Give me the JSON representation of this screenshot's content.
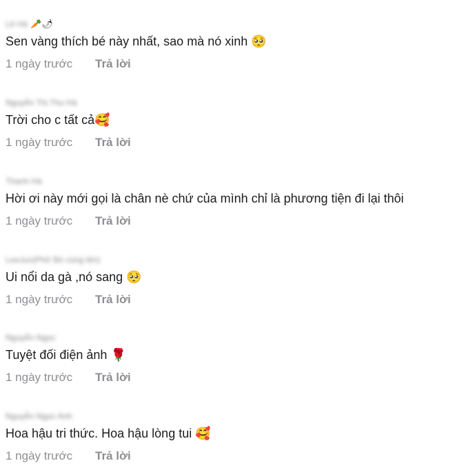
{
  "comments": [
    {
      "author": "Lê Hà",
      "author_emoji": "🥕🌶",
      "text": "Sen vàng thích bé này nhất, sao mà nó xinh 🥺",
      "time": "1 ngày trước",
      "reply": "Trả lời"
    },
    {
      "author": "Nguyễn Thị Thu Hà",
      "author_emoji": "",
      "text": "Trời cho c tất cả🥰",
      "time": "1 ngày trước",
      "reply": "Trả lời"
    },
    {
      "author": "Thanh Hà",
      "author_emoji": "",
      "text": "Hời ơi này mới gọi là chân nè chứ của mình chỉ là phương tiện đi lại thôi",
      "time": "1 ngày trước",
      "reply": "Trả lời"
    },
    {
      "author": "LeeJun(Phở Bò cùng tên)",
      "author_emoji": "",
      "text": "Ui nổi da gà ,nó sang 🥺",
      "time": "1 ngày trước",
      "reply": "Trả lời"
    },
    {
      "author": "Nguyễn Ngọc",
      "author_emoji": "",
      "text": "Tuyệt đối điện ảnh 🌹",
      "time": "1 ngày trước",
      "reply": "Trả lời"
    },
    {
      "author": "Nguyễn Ngọc Anh",
      "author_emoji": "",
      "text": "Hoa hậu tri thức. Hoa hậu lòng tui 🥰",
      "time": "1 ngày trước",
      "reply": "Trả lời"
    }
  ]
}
